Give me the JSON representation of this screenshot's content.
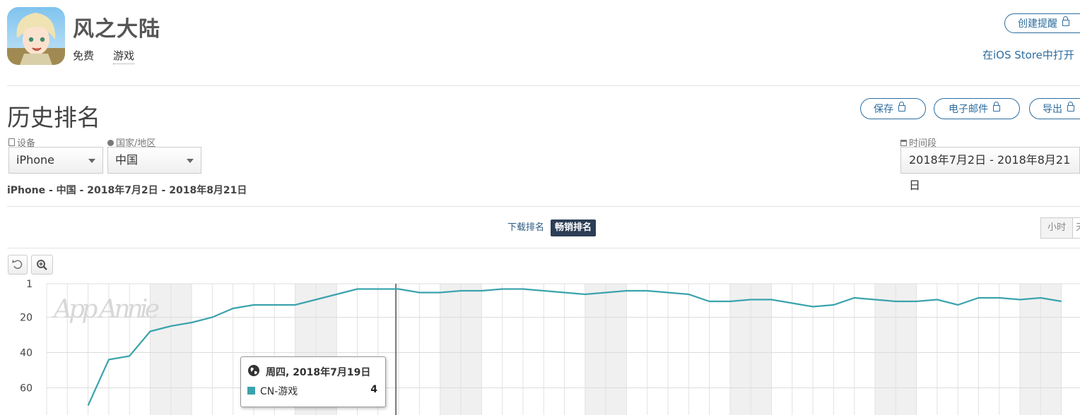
{
  "app": {
    "name": "风之大陆",
    "price": "免费",
    "category": "游戏"
  },
  "header_actions": {
    "create_alert": "创建提醒",
    "open_ios_store": "在iOS Store中打开"
  },
  "section": {
    "title": "历史排名",
    "save": "保存",
    "email": "电子邮件",
    "export": "导出"
  },
  "filters": {
    "device_label": "设备",
    "device_value": "iPhone",
    "country_label": "国家/地区",
    "country_value": "中国",
    "period_label": "时间段",
    "period_value": "2018年7月2日 - 2018年8月21日"
  },
  "summary": "iPhone - 中国 - 2018年7月2日 - 2018年8月21日",
  "tabs": {
    "downloads": "下载排名",
    "grossing": "畅销排名",
    "active": "grossing"
  },
  "granularity": {
    "hour": "小时",
    "day": "天"
  },
  "icons": {
    "reset": "undo-icon",
    "zoom": "zoom-in-icon",
    "device": "device-icon",
    "globe": "globe-icon",
    "calendar": "calendar-icon",
    "lock": "lock-icon"
  },
  "colors": {
    "series": "#3aa3ad",
    "accent": "#2d6d9f",
    "active_tab": "#2c3e55"
  },
  "watermark": "App Annie",
  "tooltip": {
    "date": "周四, 2018年7月19日",
    "series": "CN-游戏",
    "value": "4"
  },
  "chart_data": {
    "type": "line",
    "y_inverted": true,
    "ylim": [
      1,
      73
    ],
    "yticks": [
      "1",
      "20",
      "40",
      "60"
    ],
    "x": [
      "2018-07-02",
      "2018-07-03",
      "2018-07-04",
      "2018-07-05",
      "2018-07-06",
      "2018-07-07",
      "2018-07-08",
      "2018-07-09",
      "2018-07-10",
      "2018-07-11",
      "2018-07-12",
      "2018-07-13",
      "2018-07-14",
      "2018-07-15",
      "2018-07-16",
      "2018-07-17",
      "2018-07-18",
      "2018-07-19",
      "2018-07-20",
      "2018-07-21",
      "2018-07-22",
      "2018-07-23",
      "2018-07-24",
      "2018-07-25",
      "2018-07-26",
      "2018-07-27",
      "2018-07-28",
      "2018-07-29",
      "2018-07-30",
      "2018-07-31",
      "2018-08-01",
      "2018-08-02",
      "2018-08-03",
      "2018-08-04",
      "2018-08-05",
      "2018-08-06",
      "2018-08-07",
      "2018-08-08",
      "2018-08-09",
      "2018-08-10",
      "2018-08-11",
      "2018-08-12",
      "2018-08-13",
      "2018-08-14",
      "2018-08-15",
      "2018-08-16",
      "2018-08-17",
      "2018-08-18",
      "2018-08-19",
      "2018-08-20",
      "2018-08-21"
    ],
    "series": [
      {
        "name": "CN-游戏",
        "values": [
          null,
          null,
          70,
          44,
          42,
          28,
          25,
          23,
          20,
          15,
          13,
          13,
          13,
          10,
          7,
          4,
          4,
          4,
          6,
          6,
          5,
          5,
          4,
          4,
          5,
          6,
          7,
          6,
          5,
          5,
          6,
          7,
          11,
          11,
          10,
          10,
          12,
          14,
          13,
          9,
          10,
          11,
          11,
          10,
          13,
          9,
          9,
          10,
          9,
          11
        ]
      }
    ],
    "weekends": [
      "2018-07-07",
      "2018-07-08",
      "2018-07-14",
      "2018-07-15",
      "2018-07-21",
      "2018-07-22",
      "2018-07-28",
      "2018-07-29",
      "2018-08-04",
      "2018-08-05",
      "2018-08-11",
      "2018-08-12",
      "2018-08-18",
      "2018-08-19"
    ],
    "crosshair_x": "2018-07-19",
    "grid": true,
    "legend": "none"
  }
}
